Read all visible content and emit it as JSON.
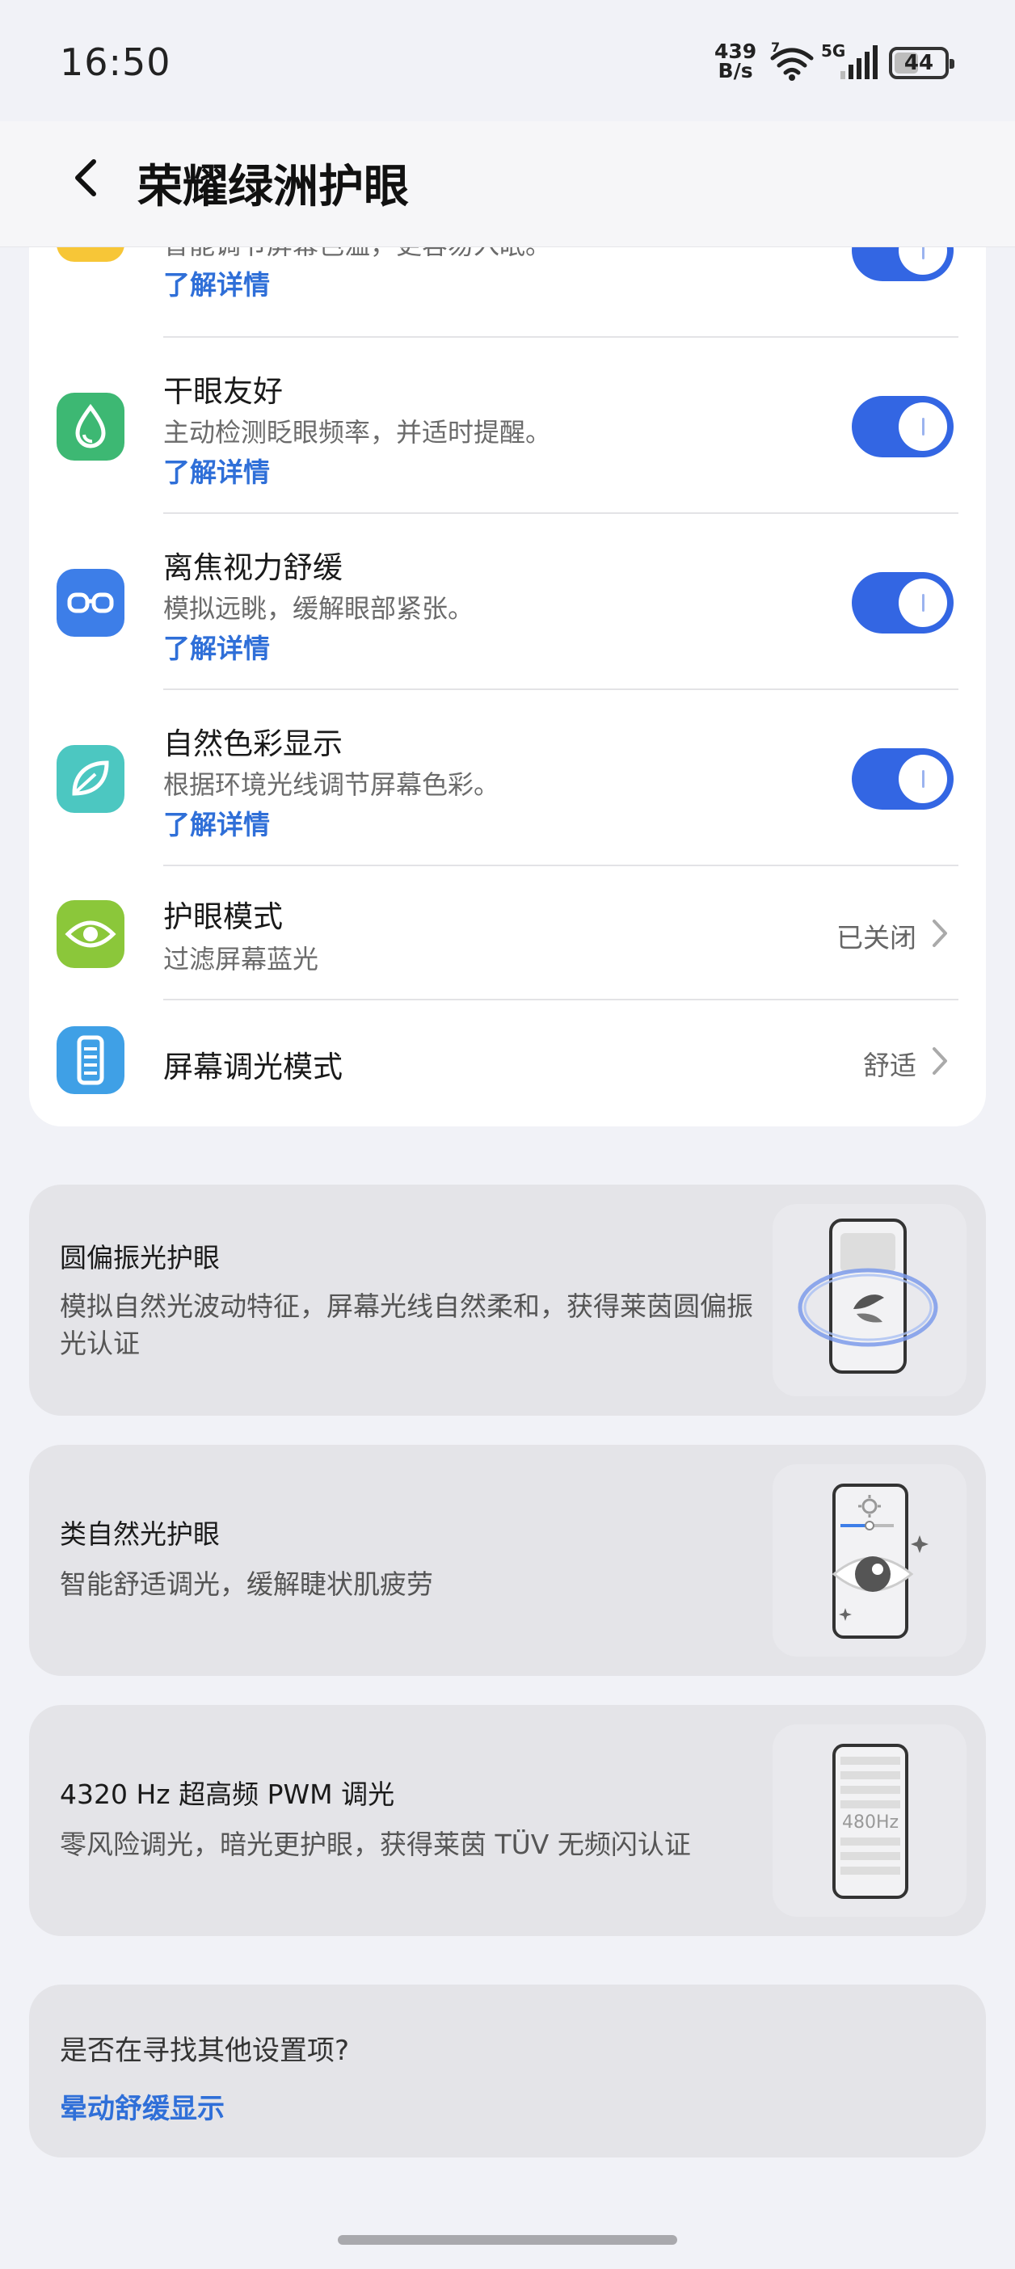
{
  "status": {
    "time": "16:50",
    "net_speed_value": "439",
    "net_speed_unit": "B/s",
    "wifi_badge": "7",
    "network_type": "5G",
    "battery": "44"
  },
  "header": {
    "title": "荣耀绿洲护眼"
  },
  "settings": [
    {
      "title": "",
      "desc": "智能调节屏幕色温，更容易入眠。",
      "link": "了解详情",
      "icon": "moon-icon",
      "icon_color": "#f7c637",
      "toggle_on": true
    },
    {
      "title": "干眼友好",
      "desc": "主动检测眨眼频率，并适时提醒。",
      "link": "了解详情",
      "icon": "water-drop-icon",
      "icon_color": "#3db873",
      "toggle_on": true
    },
    {
      "title": "离焦视力舒缓",
      "desc": "模拟远眺，缓解眼部紧张。",
      "link": "了解详情",
      "icon": "glasses-icon",
      "icon_color": "#3d7ee8",
      "toggle_on": true
    },
    {
      "title": "自然色彩显示",
      "desc": "根据环境光线调节屏幕色彩。",
      "link": "了解详情",
      "icon": "leaf-icon",
      "icon_color": "#4cc7c1",
      "toggle_on": true
    },
    {
      "title": "护眼模式",
      "desc": "过滤屏幕蓝光",
      "value": "已关闭",
      "icon": "eye-icon",
      "icon_color": "#8bc73a"
    },
    {
      "title": "屏幕调光模式",
      "value": "舒适",
      "icon": "screen-dimming-icon",
      "icon_color": "#3fa0e6"
    }
  ],
  "features": [
    {
      "title": "圆偏振光护眼",
      "desc": "模拟自然光波动特征，屏幕光线自然柔和，获得莱茵圆偏振光认证",
      "art": "circular-polarized-phone-icon"
    },
    {
      "title": "类自然光护眼",
      "desc": "智能舒适调光，缓解睫状肌疲劳",
      "art": "natural-light-phone-icon"
    },
    {
      "title": "4320 Hz 超高频 PWM 调光",
      "desc": "零风险调光，暗光更护眼，获得莱茵 TÜV 无频闪认证",
      "art": "pwm-phone-icon",
      "art_label": "480Hz"
    }
  ],
  "search": {
    "question": "是否在寻找其他设置项?",
    "link": "晕动舒缓显示"
  }
}
